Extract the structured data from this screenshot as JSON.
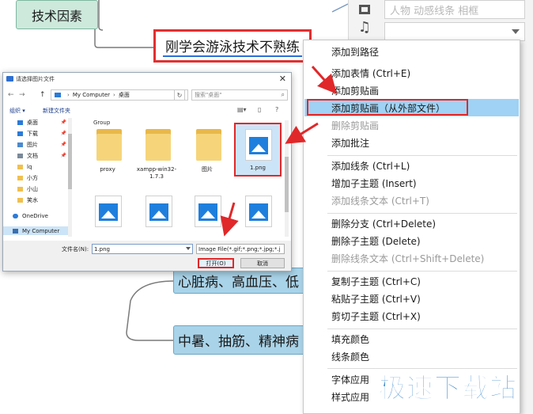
{
  "mindmap": {
    "node_tech": "技术因素",
    "node_selected": "刚学会游泳技术不熟练",
    "node_heart": "心脏病、高血压、低",
    "node_heat": "中暑、抽筋、精神病"
  },
  "side_panel": {
    "tab1_icon": "picture-icon",
    "tab2_icon": "music-icon",
    "search_placeholder": "人物 动感线条 相框",
    "select_value": ""
  },
  "context_menu": {
    "items": [
      {
        "label": "添加到路径",
        "enabled": true
      },
      {
        "label": "添加表情 (Ctrl+E)",
        "enabled": true
      },
      {
        "label": "添加剪贴画",
        "enabled": true
      },
      {
        "label": "添加剪贴画（从外部文件）",
        "enabled": true,
        "highlighted": true
      },
      {
        "label": "删除剪贴画",
        "enabled": false
      },
      {
        "label": "添加批注",
        "enabled": true
      },
      {
        "label": "添加线条 (Ctrl+L)",
        "enabled": true
      },
      {
        "label": "增加子主题 (Insert)",
        "enabled": true
      },
      {
        "label": "添加线条文本 (Ctrl+T)",
        "enabled": false
      },
      {
        "label": "删除分支 (Ctrl+Delete)",
        "enabled": true
      },
      {
        "label": "删除子主题 (Delete)",
        "enabled": true
      },
      {
        "label": "删除线条文本 (Ctrl+Shift+Delete)",
        "enabled": false
      },
      {
        "label": "复制子主题 (Ctrl+C)",
        "enabled": true
      },
      {
        "label": "粘贴子主题 (Ctrl+V)",
        "enabled": true
      },
      {
        "label": "剪切子主题 (Ctrl+X)",
        "enabled": true
      },
      {
        "label": "填充颜色",
        "enabled": true
      },
      {
        "label": "线条颜色",
        "enabled": true
      },
      {
        "label": "字体应用",
        "enabled": true
      },
      {
        "label": "样式应用",
        "enabled": true
      }
    ]
  },
  "dialog": {
    "title": "请选择图片文件",
    "close_glyph": "✕",
    "nav_back": "←",
    "nav_forward": "→",
    "nav_up": "↑",
    "breadcrumb": [
      "My Computer",
      "桌面"
    ],
    "refresh_glyph": "↻",
    "search_placeholder": "搜索\"桌面\"",
    "toolbar": {
      "organize": "组织 ▾",
      "new_folder": "新建文件夹"
    },
    "sidebar": [
      {
        "label": "桌面",
        "icon": "desktop-icon",
        "color": "#2a7bd8",
        "pinned": true
      },
      {
        "label": "下载",
        "icon": "download-icon",
        "color": "#2a7bd8",
        "pinned": true
      },
      {
        "label": "图片",
        "icon": "pictures-icon",
        "color": "#4a8ad0",
        "pinned": true
      },
      {
        "label": "文档",
        "icon": "documents-icon",
        "color": "#7a8a9a",
        "pinned": true
      },
      {
        "label": "lq",
        "icon": "folder-icon",
        "color": "#f0c050",
        "pinned": false
      },
      {
        "label": "小方",
        "icon": "folder-icon",
        "color": "#f0c050",
        "pinned": false
      },
      {
        "label": "小山",
        "icon": "folder-icon",
        "color": "#f0c050",
        "pinned": false
      },
      {
        "label": "笑水",
        "icon": "folder-icon",
        "color": "#f0c050",
        "pinned": false
      },
      {
        "label": "OneDrive",
        "icon": "cloud-icon",
        "color": "#2a7bd8",
        "pinned": false
      },
      {
        "label": "My Computer",
        "icon": "computer-icon",
        "color": "#3a6fb0",
        "pinned": false,
        "selected": true
      }
    ],
    "group_label": "Group",
    "files_row1": [
      {
        "label": "proxy",
        "kind": "folder"
      },
      {
        "label": "xampp-win32-1.7.3",
        "kind": "folder"
      },
      {
        "label": "图片",
        "kind": "folder"
      },
      {
        "label": "1.png",
        "kind": "image",
        "selected": true
      }
    ],
    "files_row2": [
      {
        "label": "",
        "kind": "image"
      },
      {
        "label": "",
        "kind": "image"
      },
      {
        "label": "",
        "kind": "image"
      },
      {
        "label": "",
        "kind": "image"
      }
    ],
    "filename_label": "文件名(N):",
    "filename_value": "1.png",
    "filetype_value": "Image File(*.gif;*.png;*.jpg;*.j",
    "open_label": "打开(O)",
    "cancel_label": "取消"
  },
  "watermark": "极速下载站",
  "colors": {
    "accent_red": "#e0282a",
    "menu_highlight": "#9fd2f4",
    "node_blue": "#a9d3e8",
    "node_green": "#cde9dc",
    "watermark_blue": "#2f80c8"
  }
}
